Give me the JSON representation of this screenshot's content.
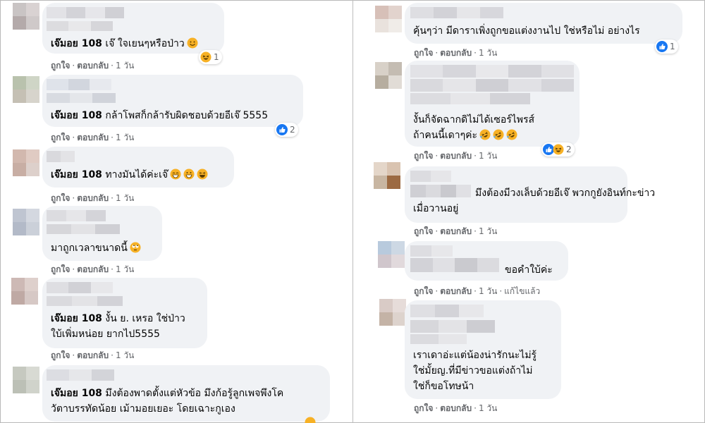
{
  "colors": {
    "bubble": "#f0f2f5",
    "like_blue": "#1877f2",
    "haha_yellow": "#f7b125",
    "meta_text": "#65676b"
  },
  "meta": {
    "like": "ถูกใจ",
    "reply": "ตอบกลับ",
    "time": "1 วัน",
    "edited": "แก้ไขแล้ว"
  },
  "left": [
    {
      "author": "เจ๊มอย 108",
      "lines": [
        "เจ๊ ใจเยนๆหรือป่าว"
      ],
      "emoji": "smile",
      "reaction": {
        "icons": [
          "haha-icon"
        ],
        "count": "1"
      }
    },
    {
      "author": "เจ๊มอย 108",
      "lines": [
        "กล้าโพสก็กล้ารับผิดชอบด้วยอีเจ๊ 5555"
      ],
      "reaction": {
        "icons": [
          "like-icon"
        ],
        "count": "2"
      }
    },
    {
      "author": "เจ๊มอย 108",
      "lines": [
        "ทางมันได้ค่ะเจ๊"
      ],
      "emoji": "grin3"
    },
    {
      "author": "",
      "lines": [
        "มาถูกเวลาขนาดนี้"
      ],
      "emoji": "rolleyes"
    },
    {
      "author": "เจ๊มอย 108",
      "lines": [
        "งั้น ย. เหรอ ใช่ป่าว",
        "ใบ้เพิ่มหน่อย ยากไป5555"
      ]
    },
    {
      "author": "เจ๊มอย 108",
      "lines": [
        "มึงต้องพาดตั้งแต่หัวข้อ มึงก้อรู้ลูกเพจพึงโค",
        "วัตาบรรทัดน้อย เม้ามอยเยอะ โดยเฉาะกูเอง"
      ]
    }
  ],
  "right": [
    {
      "lines": [
        "คุ้นๆว่า มีดาราเพิ่งถูกขอแต่งงานไป ใช่หรือไม่ อย่างไร"
      ],
      "reaction": {
        "icons": [
          "like-icon"
        ],
        "count": "1"
      }
    },
    {
      "lines": [
        "งั้นก็จัดฉากดิไม่ได้เซอร์ไพรส์",
        "ถ้าคนนี้เดาๆค่ะ"
      ],
      "emoji": "rofl2",
      "reaction": {
        "icons": [
          "like-icon",
          "haha-icon"
        ],
        "count": "2"
      }
    },
    {
      "lines": [
        "มึงต้องมีวงเล็บด้วยอีเจ๊ พวกกูยังอินท์กะข่าว",
        "เมื่อวานอยู่"
      ]
    },
    {
      "lines": [
        "ขอคำใบ้ค่ะ"
      ],
      "edited": true
    },
    {
      "lines": [
        "เราเดาอ่ะแต่น้องน่ารักนะไม่รู้",
        "ใช่มั้ยญ.ที่มีข่าวขอแต่งถ้าไม่",
        "ใช่ก็ขอโทษน้า"
      ]
    }
  ]
}
